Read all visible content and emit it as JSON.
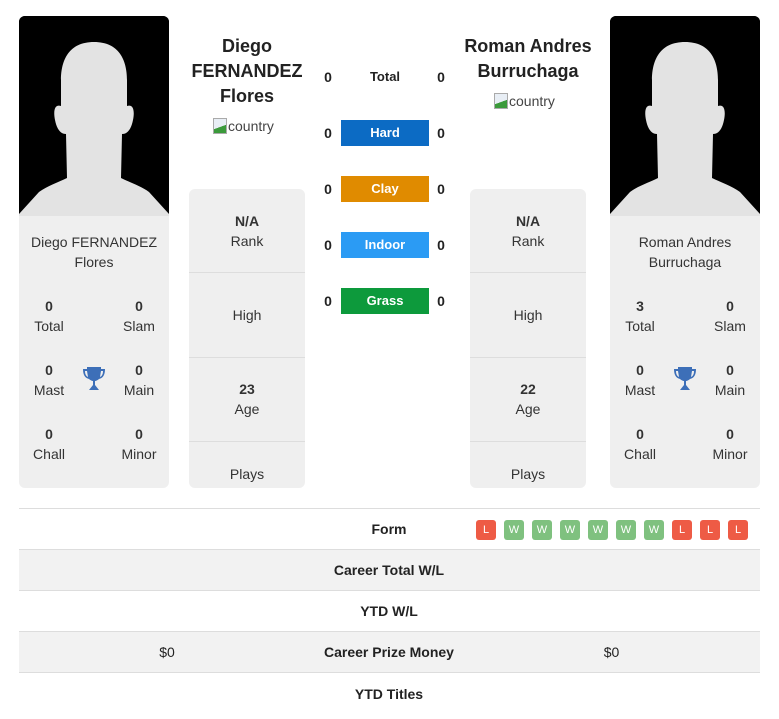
{
  "player1": {
    "name_lines": [
      "Diego",
      "FERNANDEZ",
      "Flores"
    ],
    "card_name_lines": [
      "Diego FERNANDEZ",
      "Flores"
    ],
    "flag_alt": "country",
    "rank": "N/A",
    "rank_label": "Rank",
    "high_label": "High",
    "age": "23",
    "age_label": "Age",
    "plays_label": "Plays",
    "titles": {
      "total": "0",
      "total_label": "Total",
      "slam": "0",
      "slam_label": "Slam",
      "mast": "0",
      "mast_label": "Mast",
      "main": "0",
      "main_label": "Main",
      "chall": "0",
      "chall_label": "Chall",
      "minor": "0",
      "minor_label": "Minor"
    }
  },
  "player2": {
    "name_lines": [
      "Roman Andres",
      "Burruchaga"
    ],
    "card_name_lines": [
      "Roman Andres",
      "Burruchaga"
    ],
    "flag_alt": "country",
    "rank": "N/A",
    "rank_label": "Rank",
    "high_label": "High",
    "age": "22",
    "age_label": "Age",
    "plays_label": "Plays",
    "titles": {
      "total": "3",
      "total_label": "Total",
      "slam": "0",
      "slam_label": "Slam",
      "mast": "0",
      "mast_label": "Mast",
      "main": "0",
      "main_label": "Main",
      "chall": "0",
      "chall_label": "Chall",
      "minor": "0",
      "minor_label": "Minor"
    }
  },
  "h2h": [
    {
      "label": "Total",
      "p1": "0",
      "p2": "0",
      "color": ""
    },
    {
      "label": "Hard",
      "p1": "0",
      "p2": "0",
      "color": "#0c6bc4"
    },
    {
      "label": "Clay",
      "p1": "0",
      "p2": "0",
      "color": "#e08b00"
    },
    {
      "label": "Indoor",
      "p1": "0",
      "p2": "0",
      "color": "#2b9bf4"
    },
    {
      "label": "Grass",
      "p1": "0",
      "p2": "0",
      "color": "#0d9a3c"
    }
  ],
  "table": {
    "form_label": "Form",
    "form": [
      "L",
      "W",
      "W",
      "W",
      "W",
      "W",
      "W",
      "L",
      "L",
      "L"
    ],
    "rows": [
      {
        "label": "Career Total W/L",
        "p1": "",
        "p2": ""
      },
      {
        "label": "YTD W/L",
        "p1": "",
        "p2": ""
      },
      {
        "label": "Career Prize Money",
        "p1": "$0",
        "p2": "$0"
      },
      {
        "label": "YTD Titles",
        "p1": "",
        "p2": ""
      }
    ]
  }
}
